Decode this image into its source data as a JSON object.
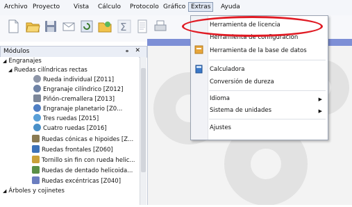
{
  "menubar": {
    "items": [
      "Archivo",
      "Proyecto",
      "Vista",
      "Cálculo",
      "Protocolo",
      "Gráfico",
      "Extras",
      "Ayuda"
    ]
  },
  "panel": {
    "title": "Módulos",
    "buttons": "ₒ ✕"
  },
  "tree": [
    {
      "label": "Engranajes",
      "level": 0,
      "expanded": true
    },
    {
      "label": "Ruedas cilíndricas rectas",
      "level": 1,
      "expanded": true
    },
    {
      "label": "Rueda individual [Z011]",
      "level": 2,
      "icon": "gear-icon"
    },
    {
      "label": "Engranaje cilíndrico [Z012]",
      "level": 2,
      "icon": "gear-pair-icon"
    },
    {
      "label": "Piñón-cremallera [Z013]",
      "level": 2,
      "icon": "rack-icon"
    },
    {
      "label": "Engranaje planetario [Z0...",
      "level": 2,
      "icon": "planetary-icon"
    },
    {
      "label": "Tres ruedas [Z015]",
      "level": 2,
      "icon": "three-gears-icon"
    },
    {
      "label": "Cuatro ruedas [Z016]",
      "level": 2,
      "icon": "four-gears-icon"
    },
    {
      "label": "Ruedas cónicas e hipoides [Z...",
      "level": 1,
      "icon": "bevel-gear-icon"
    },
    {
      "label": "Ruedas frontales [Z060]",
      "level": 1,
      "icon": "face-gear-icon"
    },
    {
      "label": "Tornillo sin fin con rueda helic...",
      "level": 1,
      "icon": "worm-icon"
    },
    {
      "label": "Ruedas de dentado helicoida...",
      "level": 1,
      "icon": "helical-icon"
    },
    {
      "label": "Ruedas excéntricas [Z040]",
      "level": 1,
      "icon": "eccentric-icon"
    },
    {
      "label": "Árboles y cojinetes",
      "level": 0,
      "expanded": true
    }
  ],
  "extras_menu": {
    "items": [
      {
        "label": "Herramienta de licencia",
        "submenu": false
      },
      {
        "label": "Herramienta de configuración",
        "submenu": false
      },
      {
        "label": "Herramienta de la base de datos",
        "submenu": false
      },
      {
        "label": "Calculadora",
        "submenu": false
      },
      {
        "label": "Conversión de dureza",
        "submenu": false
      },
      {
        "label": "Idioma",
        "submenu": true
      },
      {
        "label": "Sistema de unidades",
        "submenu": true
      },
      {
        "label": "Ajustes",
        "submenu": false
      }
    ],
    "arrow": "▶"
  },
  "colors": {
    "highlight": "#e01b24",
    "accent": "#7d8fd6"
  }
}
